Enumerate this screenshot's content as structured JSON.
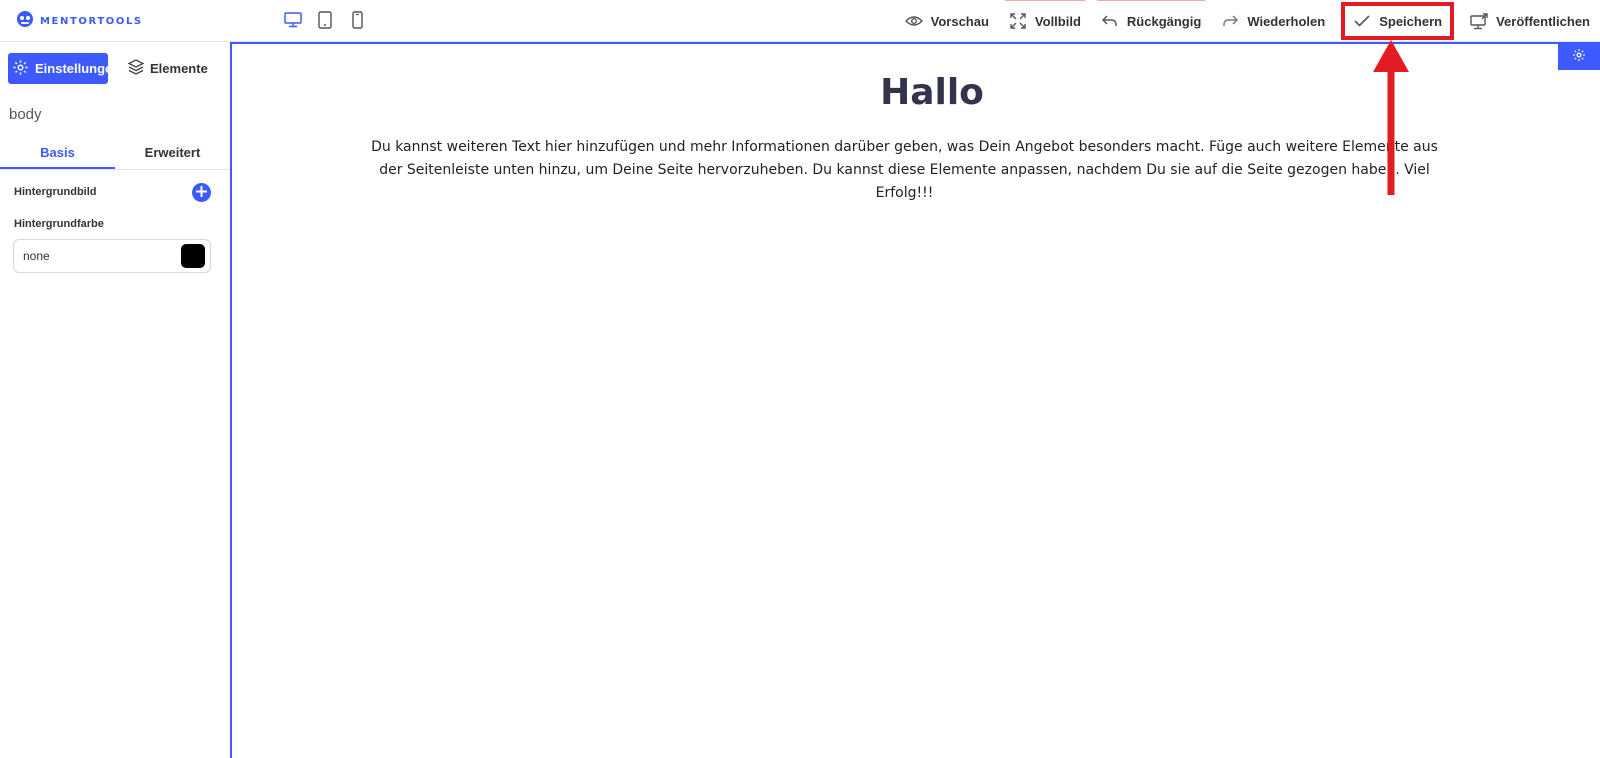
{
  "app": {
    "logo_text": "MENTORTOOLS"
  },
  "devices": [
    "desktop-icon",
    "tablet-icon",
    "mobile-icon"
  ],
  "toolbar": {
    "preview_label": "Vorschau",
    "fullscreen_label": "Vollbild",
    "undo_label": "Rückgängig",
    "redo_label": "Wiederholen",
    "save_label": "Speichern",
    "publish_label": "Veröffentlichen"
  },
  "sidebar": {
    "tabs": [
      {
        "label": "Einstellungen",
        "icon": "gear-icon",
        "active": true
      },
      {
        "label": "Elemente",
        "icon": "layers-icon",
        "active": false
      }
    ],
    "context": "body",
    "subtabs": [
      {
        "label": "Basis",
        "active": true
      },
      {
        "label": "Erweitert",
        "active": false
      }
    ],
    "background_image_label": "Hintergrundbild",
    "background_color_label": "Hintergrundfarbe",
    "background_color_value": "none",
    "swatch_color": "#000000"
  },
  "canvas": {
    "heading": "Hallo",
    "body_text": "Du kannst weiteren Text hier hinzufügen und mehr Informationen darüber geben, was Dein Angebot besonders macht. Füge auch weitere Elemente aus der Seitenleiste unten hinzu, um Deine Seite hervorzuheben. Du kannst diese Elemente anpassen, nachdem Du sie auf die Seite gezogen haben. Viel Erfolg!!!"
  },
  "colors": {
    "accent": "#3d5afe",
    "annotation": "#e31b23"
  }
}
